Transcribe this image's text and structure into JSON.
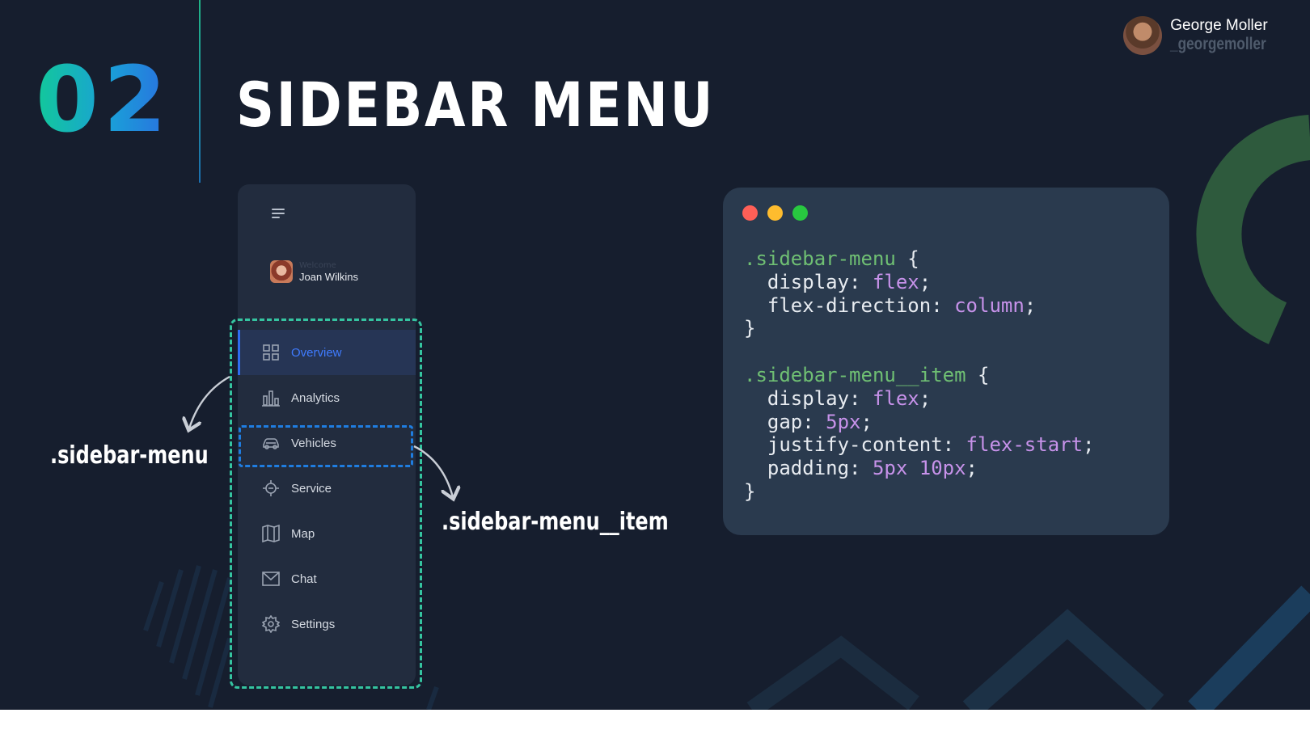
{
  "slide": {
    "number": "02",
    "title": "SIDEBAR MENU"
  },
  "author": {
    "name": "George Moller",
    "handle": "_georgemoller"
  },
  "sidebar": {
    "user": {
      "welcome": "Welcome",
      "name": "Joan Wilkins"
    },
    "items": [
      {
        "label": "Overview",
        "icon": "grid-icon",
        "active": true
      },
      {
        "label": "Analytics",
        "icon": "bar-chart-icon",
        "active": false
      },
      {
        "label": "Vehicles",
        "icon": "car-icon",
        "active": false
      },
      {
        "label": "Service",
        "icon": "wrench-icon",
        "active": false
      },
      {
        "label": "Map",
        "icon": "map-icon",
        "active": false
      },
      {
        "label": "Chat",
        "icon": "envelope-icon",
        "active": false
      },
      {
        "label": "Settings",
        "icon": "gear-icon",
        "active": false
      }
    ]
  },
  "labels": {
    "menu": ".sidebar-menu",
    "item": ".sidebar-menu__item"
  },
  "code": {
    "block1": {
      "selector": ".sidebar-menu",
      "open": " {",
      "l1_prop": "  display: ",
      "l1_val": "flex",
      "l2_prop": "  flex-direction: ",
      "l2_val": "column",
      "close": "}"
    },
    "block2": {
      "selector": ".sidebar-menu__item",
      "open": " {",
      "l1_prop": "  display: ",
      "l1_val": "flex",
      "l2_prop": "  gap: ",
      "l2_val": "5px",
      "l3_prop": "  justify-content: ",
      "l3_val": "flex-start",
      "l4_prop": "  padding: ",
      "l4_val": "5px 10px",
      "close": "}"
    },
    "semicolon": ";"
  },
  "colors": {
    "background": "#161e2e",
    "accent_green": "#35c4a0",
    "accent_blue": "#1f7de0",
    "code_selector": "#6fbf73",
    "code_value": "#c792ea",
    "window_red": "#ff5f57",
    "window_yellow": "#febc2e",
    "window_green": "#28c840"
  }
}
